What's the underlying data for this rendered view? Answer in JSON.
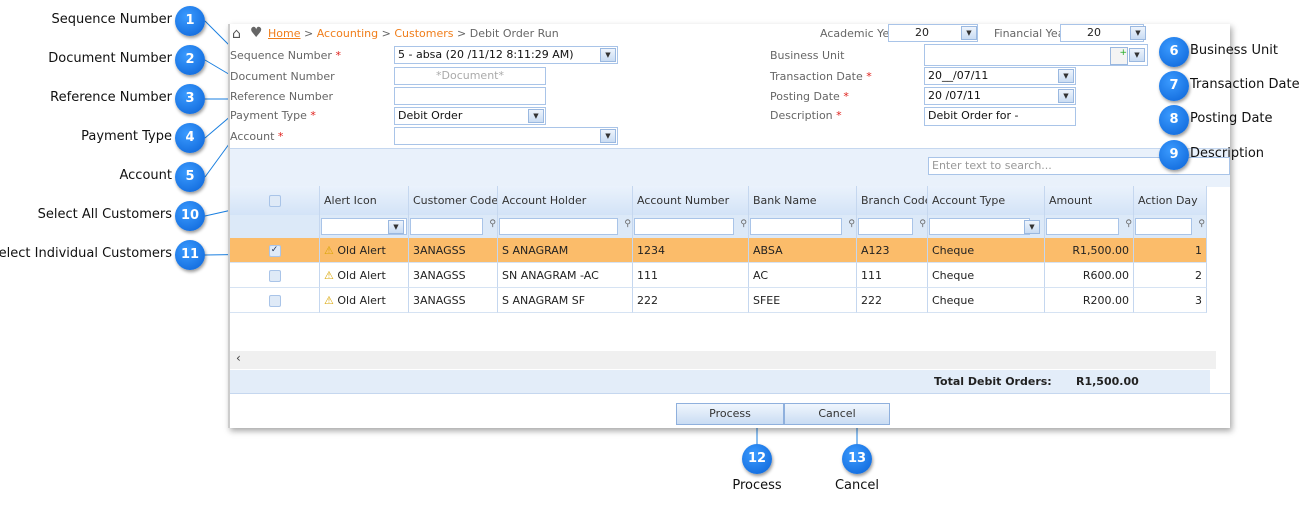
{
  "breadcrumb": {
    "home": "Home",
    "accounting": "Accounting",
    "customers": "Customers",
    "current": "Debit Order Run",
    "sep": " > "
  },
  "top": {
    "academic_year_label": "Academic Year",
    "academic_year": "20",
    "financial_year_label": "Financial Year",
    "financial_year": "20"
  },
  "form": {
    "sequence_label": "Sequence Number",
    "sequence_value": "5 - absa (20    /11/12 8:11:29 AM)",
    "document_label": "Document Number",
    "document_placeholder": "*Document*",
    "reference_label": "Reference Number",
    "reference_value": "",
    "payment_type_label": "Payment Type",
    "payment_type_value": "Debit Order",
    "account_label": "Account",
    "account_value": "",
    "business_unit_label": "Business Unit",
    "business_unit_value": "",
    "transaction_date_label": "Transaction Date",
    "transaction_date_value": "20__/07/11",
    "posting_date_label": "Posting Date",
    "posting_date_value": "20  /07/11",
    "description_label": "Description",
    "description_value": "Debit Order for -",
    "required_mark": "*"
  },
  "search": {
    "placeholder": "Enter text to search..."
  },
  "grid": {
    "columns": [
      "",
      "Alert Icon",
      "Customer Code",
      "Account Holder",
      "Account Number",
      "Bank Name",
      "Branch Code",
      "Account Type",
      "Amount",
      "Action Day"
    ],
    "rows": [
      {
        "checked": true,
        "alert": "Old Alert",
        "code": "3ANAGSS",
        "holder": "S ANAGRAM",
        "acc": "1234",
        "bank": "ABSA",
        "branch": "A123",
        "type": "Cheque",
        "amount": "R1,500.00",
        "day": "1"
      },
      {
        "checked": false,
        "alert": "Old Alert",
        "code": "3ANAGSS",
        "holder": "SN ANAGRAM -AC",
        "acc": "111",
        "bank": "AC",
        "branch": "111",
        "type": "Cheque",
        "amount": "R600.00",
        "day": "2"
      },
      {
        "checked": false,
        "alert": "Old Alert",
        "code": "3ANAGSS",
        "holder": "S ANAGRAM SF",
        "acc": "222",
        "bank": "SFEE",
        "branch": "222",
        "type": "Cheque",
        "amount": "R200.00",
        "day": "3"
      }
    ],
    "total_label": "Total Debit Orders:",
    "total_value": "R1,500.00"
  },
  "buttons": {
    "process": "Process",
    "cancel": "Cancel"
  },
  "callouts": [
    {
      "n": "1",
      "label": "Sequence Number"
    },
    {
      "n": "2",
      "label": "Document Number"
    },
    {
      "n": "3",
      "label": "Reference Number"
    },
    {
      "n": "4",
      "label": "Payment Type"
    },
    {
      "n": "5",
      "label": "Account"
    },
    {
      "n": "10",
      "label": "Select All Customers"
    },
    {
      "n": "11",
      "label": "Select Individual Customers"
    },
    {
      "n": "6",
      "label": "Business Unit"
    },
    {
      "n": "7",
      "label": "Transaction Date"
    },
    {
      "n": "8",
      "label": "Posting Date"
    },
    {
      "n": "9",
      "label": "Description"
    },
    {
      "n": "12",
      "label": "Process"
    },
    {
      "n": "13",
      "label": "Cancel"
    }
  ],
  "colors": {
    "accent": "#0a62d6",
    "selected_row": "#fbbc6a",
    "link": "#f07e1b"
  }
}
